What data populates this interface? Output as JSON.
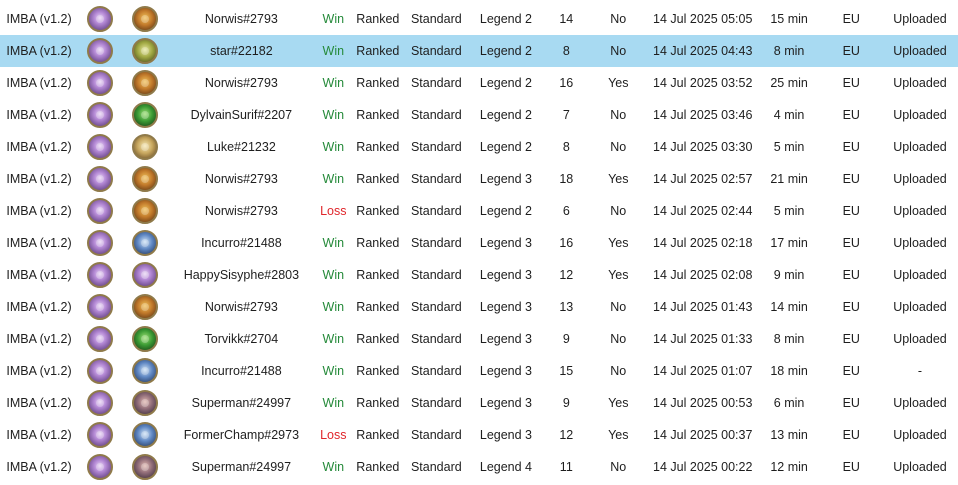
{
  "rows": [
    {
      "deck": "IMBA (v1.2)",
      "player_icon": "mage-portrait-icon",
      "opponent_icon": "warrior-portrait-icon",
      "opponent": "Norwis#2793",
      "result": "Win",
      "mode": "Ranked",
      "format": "Standard",
      "rank": "Legend 2",
      "turns": "14",
      "coin": "No",
      "date": "14 Jul 2025 05:05",
      "duration": "15 min",
      "region": "EU",
      "uploaded": "Uploaded",
      "selected": false
    },
    {
      "deck": "IMBA (v1.2)",
      "player_icon": "mage-portrait-icon",
      "opponent_icon": "hunter-portrait-icon",
      "opponent": "star#22182",
      "result": "Win",
      "mode": "Ranked",
      "format": "Standard",
      "rank": "Legend 2",
      "turns": "8",
      "coin": "No",
      "date": "14 Jul 2025 04:43",
      "duration": "8 min",
      "region": "EU",
      "uploaded": "Uploaded",
      "selected": true
    },
    {
      "deck": "IMBA (v1.2)",
      "player_icon": "mage-portrait-icon",
      "opponent_icon": "warrior-portrait-icon",
      "opponent": "Norwis#2793",
      "result": "Win",
      "mode": "Ranked",
      "format": "Standard",
      "rank": "Legend 2",
      "turns": "16",
      "coin": "Yes",
      "date": "14 Jul 2025 03:52",
      "duration": "25 min",
      "region": "EU",
      "uploaded": "Uploaded",
      "selected": false
    },
    {
      "deck": "IMBA (v1.2)",
      "player_icon": "mage-portrait-icon",
      "opponent_icon": "orc-portrait-icon",
      "opponent": "DylvainSurif#2207",
      "result": "Win",
      "mode": "Ranked",
      "format": "Standard",
      "rank": "Legend 2",
      "turns": "7",
      "coin": "No",
      "date": "14 Jul 2025 03:46",
      "duration": "4 min",
      "region": "EU",
      "uploaded": "Uploaded",
      "selected": false
    },
    {
      "deck": "IMBA (v1.2)",
      "player_icon": "mage-portrait-icon",
      "opponent_icon": "paladin-portrait-icon",
      "opponent": "Luke#21232",
      "result": "Win",
      "mode": "Ranked",
      "format": "Standard",
      "rank": "Legend 2",
      "turns": "8",
      "coin": "No",
      "date": "14 Jul 2025 03:30",
      "duration": "5 min",
      "region": "EU",
      "uploaded": "Uploaded",
      "selected": false
    },
    {
      "deck": "IMBA (v1.2)",
      "player_icon": "mage-portrait-icon",
      "opponent_icon": "warrior-portrait-icon",
      "opponent": "Norwis#2793",
      "result": "Win",
      "mode": "Ranked",
      "format": "Standard",
      "rank": "Legend 3",
      "turns": "18",
      "coin": "Yes",
      "date": "14 Jul 2025 02:57",
      "duration": "21 min",
      "region": "EU",
      "uploaded": "Uploaded",
      "selected": false
    },
    {
      "deck": "IMBA (v1.2)",
      "player_icon": "mage-portrait-icon",
      "opponent_icon": "warrior-portrait-icon",
      "opponent": "Norwis#2793",
      "result": "Loss",
      "mode": "Ranked",
      "format": "Standard",
      "rank": "Legend 2",
      "turns": "6",
      "coin": "No",
      "date": "14 Jul 2025 02:44",
      "duration": "5 min",
      "region": "EU",
      "uploaded": "Uploaded",
      "selected": false
    },
    {
      "deck": "IMBA (v1.2)",
      "player_icon": "mage-portrait-icon",
      "opponent_icon": "knight-portrait-icon",
      "opponent": "Incurro#21488",
      "result": "Win",
      "mode": "Ranked",
      "format": "Standard",
      "rank": "Legend 3",
      "turns": "16",
      "coin": "Yes",
      "date": "14 Jul 2025 02:18",
      "duration": "17 min",
      "region": "EU",
      "uploaded": "Uploaded",
      "selected": false
    },
    {
      "deck": "IMBA (v1.2)",
      "player_icon": "mage-portrait-icon",
      "opponent_icon": "mage-portrait-icon",
      "opponent": "HappySisyphe#2803",
      "result": "Win",
      "mode": "Ranked",
      "format": "Standard",
      "rank": "Legend 3",
      "turns": "12",
      "coin": "Yes",
      "date": "14 Jul 2025 02:08",
      "duration": "9 min",
      "region": "EU",
      "uploaded": "Uploaded",
      "selected": false
    },
    {
      "deck": "IMBA (v1.2)",
      "player_icon": "mage-portrait-icon",
      "opponent_icon": "warrior-portrait-icon",
      "opponent": "Norwis#2793",
      "result": "Win",
      "mode": "Ranked",
      "format": "Standard",
      "rank": "Legend 3",
      "turns": "13",
      "coin": "No",
      "date": "14 Jul 2025 01:43",
      "duration": "14 min",
      "region": "EU",
      "uploaded": "Uploaded",
      "selected": false
    },
    {
      "deck": "IMBA (v1.2)",
      "player_icon": "mage-portrait-icon",
      "opponent_icon": "orc-portrait-icon",
      "opponent": "Torvikk#2704",
      "result": "Win",
      "mode": "Ranked",
      "format": "Standard",
      "rank": "Legend 3",
      "turns": "9",
      "coin": "No",
      "date": "14 Jul 2025 01:33",
      "duration": "8 min",
      "region": "EU",
      "uploaded": "Uploaded",
      "selected": false
    },
    {
      "deck": "IMBA (v1.2)",
      "player_icon": "mage-portrait-icon",
      "opponent_icon": "knight-portrait-icon",
      "opponent": "Incurro#21488",
      "result": "Win",
      "mode": "Ranked",
      "format": "Standard",
      "rank": "Legend 3",
      "turns": "15",
      "coin": "No",
      "date": "14 Jul 2025 01:07",
      "duration": "18 min",
      "region": "EU",
      "uploaded": "-",
      "selected": false
    },
    {
      "deck": "IMBA (v1.2)",
      "player_icon": "mage-portrait-icon",
      "opponent_icon": "rogue-portrait-icon",
      "opponent": "Superman#24997",
      "result": "Win",
      "mode": "Ranked",
      "format": "Standard",
      "rank": "Legend 3",
      "turns": "9",
      "coin": "Yes",
      "date": "14 Jul 2025 00:53",
      "duration": "6 min",
      "region": "EU",
      "uploaded": "Uploaded",
      "selected": false
    },
    {
      "deck": "IMBA (v1.2)",
      "player_icon": "mage-portrait-icon",
      "opponent_icon": "knight-portrait-icon",
      "opponent": "FormerChamp#2973",
      "result": "Loss",
      "mode": "Ranked",
      "format": "Standard",
      "rank": "Legend 3",
      "turns": "12",
      "coin": "Yes",
      "date": "14 Jul 2025 00:37",
      "duration": "13 min",
      "region": "EU",
      "uploaded": "Uploaded",
      "selected": false
    },
    {
      "deck": "IMBA (v1.2)",
      "player_icon": "mage-portrait-icon",
      "opponent_icon": "rogue-portrait-icon",
      "opponent": "Superman#24997",
      "result": "Win",
      "mode": "Ranked",
      "format": "Standard",
      "rank": "Legend 4",
      "turns": "11",
      "coin": "No",
      "date": "14 Jul 2025 00:22",
      "duration": "12 min",
      "region": "EU",
      "uploaded": "Uploaded",
      "selected": false
    }
  ],
  "colors": {
    "win": "#258a3a",
    "loss": "#e0262b",
    "selected_row": "#a8daf2"
  }
}
